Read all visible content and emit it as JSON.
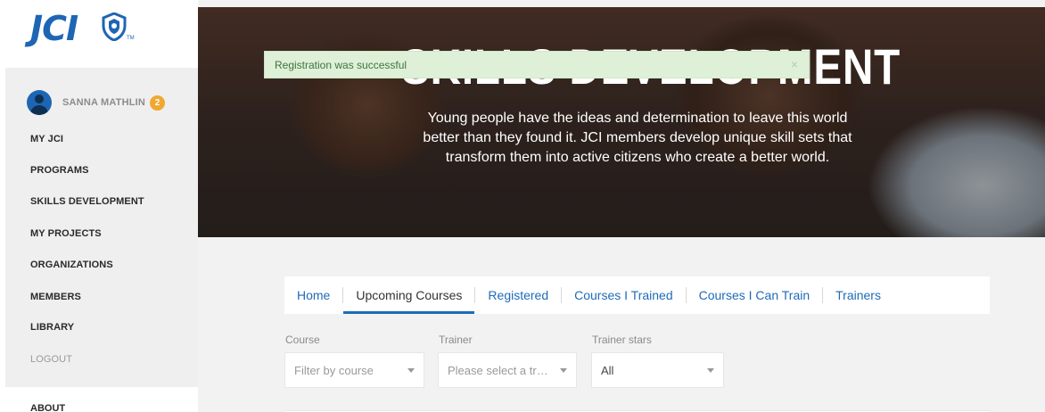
{
  "brand": {
    "logo_text": "JCI",
    "trademark": "TM",
    "primary_color": "#1e66b4"
  },
  "user": {
    "name": "SANNA MATHLIN",
    "notification_count": "2"
  },
  "sidebar": {
    "items": [
      {
        "label": "MY JCI"
      },
      {
        "label": "PROGRAMS"
      },
      {
        "label": "SKILLS DEVELOPMENT"
      },
      {
        "label": "MY PROJECTS"
      },
      {
        "label": "ORGANIZATIONS"
      },
      {
        "label": "MEMBERS"
      },
      {
        "label": "LIBRARY"
      },
      {
        "label": "LOGOUT"
      }
    ],
    "about_label": "ABOUT"
  },
  "hero": {
    "title": "SKILLS DEVELOPMENT",
    "description": "Young people have the ideas and determination to leave this world better than they found it. JCI members develop unique skill sets that transform them into active citizens who create a better world."
  },
  "toast": {
    "message": "Registration was successful",
    "close_symbol": "×",
    "color": "#dff0d8"
  },
  "tabs": [
    {
      "label": "Home"
    },
    {
      "label": "Upcoming Courses",
      "active": true
    },
    {
      "label": "Registered"
    },
    {
      "label": "Courses I Trained"
    },
    {
      "label": "Courses I Can Train"
    },
    {
      "label": "Trainers"
    }
  ],
  "filters": {
    "course": {
      "label": "Course",
      "value": "Filter by course"
    },
    "trainer": {
      "label": "Trainer",
      "value": "Please select a tr…"
    },
    "stars": {
      "label": "Trainer stars",
      "value": "All"
    }
  }
}
